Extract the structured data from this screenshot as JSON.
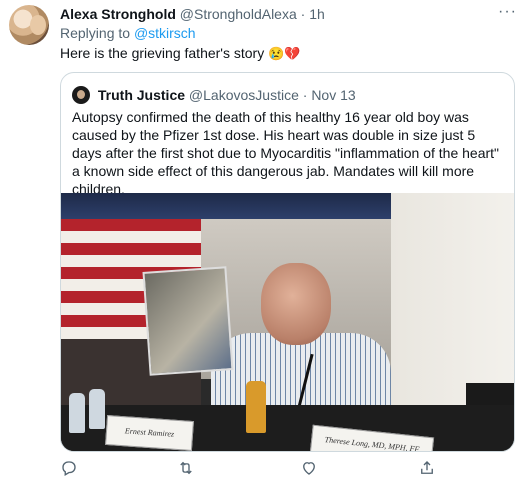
{
  "tweet": {
    "author_name": "Alexa Stronghold",
    "author_handle": "@StrongholdAlexa",
    "separator": "·",
    "time": "1h",
    "more_label": "···",
    "replying_prefix": "Replying to",
    "replying_handle": "@stkirsch",
    "text": "Here is the grieving father's story",
    "emojis": "😢💔"
  },
  "quote": {
    "author_name": "Truth Justice",
    "author_handle": "@LakovosJustice",
    "separator": "·",
    "date": "Nov 13",
    "text": "Autopsy confirmed the death of this healthy 16 year old boy was caused by the Pfizer 1st dose. His heart was double in size just 5 days after the first shot due to Myocarditis \"inflammation of the heart\" a known side effect of this dangerous jab. Mandates will kill more children.",
    "media": {
      "nameplate_1": "Ernest Ramirez",
      "nameplate_2": "Therese Long, MD, MPH, FF"
    }
  },
  "actions": {
    "icons": [
      "reply-icon",
      "retweet-icon",
      "like-icon",
      "share-icon"
    ]
  },
  "colors": {
    "link": "#1d9bf0",
    "muted": "#536471",
    "border": "#cfd9de"
  }
}
